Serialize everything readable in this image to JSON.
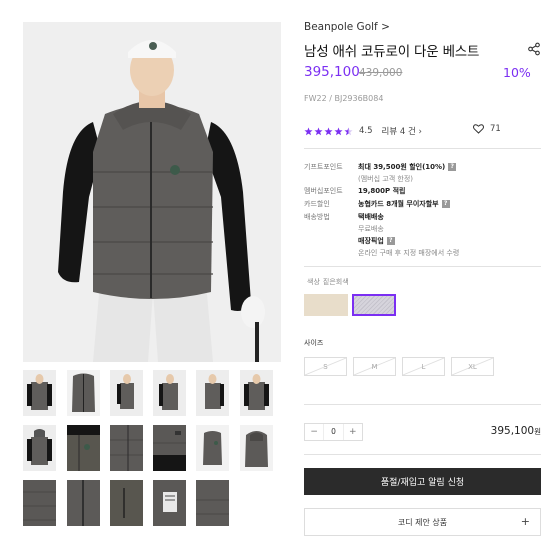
{
  "brand": "Beanpole Golf >",
  "product": {
    "title": "남성 애쉬 코듀로이 다운 베스트",
    "price": "395,100",
    "original_price": "439,000",
    "discount": "10%",
    "code": "FW22 / BJ2936B084"
  },
  "rating": {
    "stars": 4.5,
    "value": "4.5",
    "review_text": "리뷰  4 건 ›",
    "likes": "71"
  },
  "info": {
    "gift_label": "기프트포인트",
    "gift_value": "최대 39,500원 할인(10%)",
    "gift_note": "(멤버십 고객 한정)",
    "member_label": "멤버십포인트",
    "member_value": "19,800P 적립",
    "card_label": "카드할인",
    "card_value": "농협카드 8개월 무이자할부",
    "ship_label": "배송방법",
    "ship_value": "택배배송",
    "ship_note": "무료배송",
    "pickup_value": "매장픽업",
    "pickup_note": "온라인 구매 후 지정 매장에서 수령",
    "qmark": "?"
  },
  "color": {
    "label": "색상",
    "selected": "짙은회색",
    "swatches": [
      "#e8ddca",
      "#d6d4dc"
    ],
    "accent": "#7b2ff2"
  },
  "sizes": {
    "label": "사이즈",
    "options": [
      "S",
      "M",
      "L",
      "XL"
    ]
  },
  "quantity": {
    "minus": "−",
    "value": "0",
    "plus": "+"
  },
  "total": {
    "amount": "395,100",
    "unit": "원"
  },
  "buttons": {
    "notify": "품절/재입고 알림 신청",
    "coordi": "코디 제안 상품",
    "coordi_plus": "+"
  }
}
